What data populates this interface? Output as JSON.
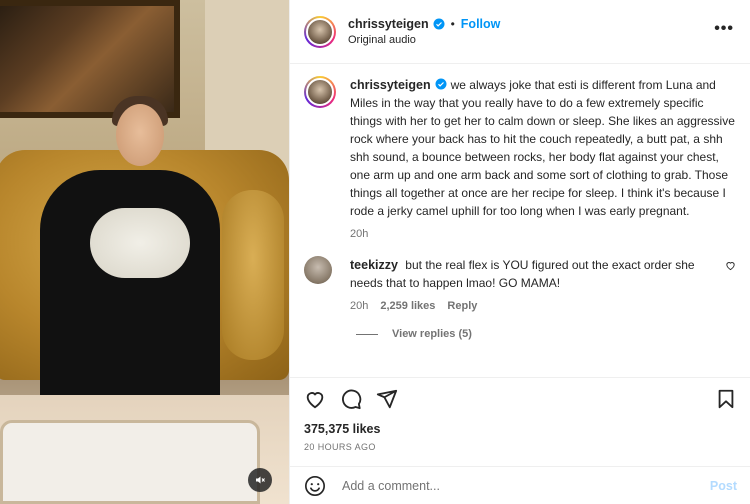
{
  "post": {
    "author": "chrissyteigen",
    "audio_label": "Original audio",
    "follow_label": "Follow",
    "separator": "•",
    "more_label": "•••",
    "caption": "we always joke that esti is different from Luna and Miles in the way that you really have to do a few extremely specific things with her to get her to calm down or sleep. She likes an aggressive rock where your back has to hit the couch repeatedly, a butt pat, a shh shh sound, a bounce between rocks, her body flat against your chest, one arm up and one arm back and some sort of clothing to grab. Those things all together at once are her recipe for sleep. I think it's because I rode a jerky camel uphill for too long when I was early pregnant.",
    "caption_age": "20h"
  },
  "comments": [
    {
      "user": "teekizzy",
      "text": "but the real flex is YOU figured out the exact order she needs that to happen lmao! GO MAMA!",
      "age": "20h",
      "likes": "2,259 likes",
      "reply_label": "Reply",
      "view_replies": "View replies (5)"
    }
  ],
  "engagement": {
    "likes": "375,375 likes",
    "time": "20 HOURS AGO"
  },
  "composer": {
    "placeholder": "Add a comment...",
    "post_label": "Post"
  },
  "icons": {
    "verified": "verified-badge-icon",
    "like": "heart-icon",
    "comment": "comment-bubble-icon",
    "share": "paper-plane-icon",
    "save": "bookmark-icon",
    "emoji": "smiley-icon",
    "mute": "speaker-muted-icon",
    "more": "ellipsis-icon"
  },
  "colors": {
    "link_blue": "#0095f6",
    "post_disabled": "#b3dbff",
    "verified_blue": "#0095f6",
    "muted_text": "#737373"
  }
}
